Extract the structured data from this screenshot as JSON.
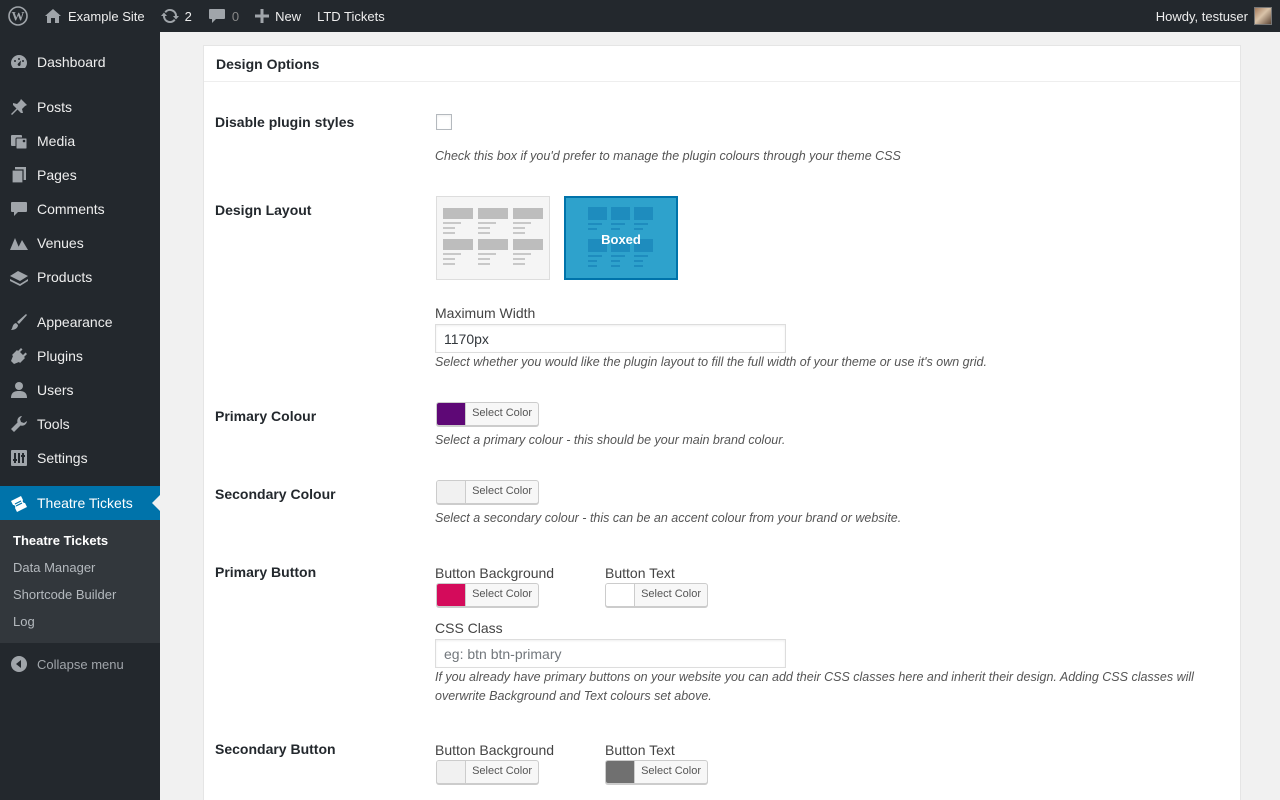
{
  "adminbar": {
    "site_name": "Example Site",
    "updates_count": "2",
    "comments_count": "0",
    "new_label": "New",
    "plugin_link": "LTD Tickets",
    "greeting": "Howdy, testuser"
  },
  "sidebar": {
    "items": [
      {
        "label": "Dashboard",
        "icon": "dashboard-icon"
      },
      {
        "label": "Posts",
        "icon": "pushpin-icon"
      },
      {
        "label": "Media",
        "icon": "media-icon"
      },
      {
        "label": "Pages",
        "icon": "pages-icon"
      },
      {
        "label": "Comments",
        "icon": "comment-icon"
      },
      {
        "label": "Venues",
        "icon": "venues-icon"
      },
      {
        "label": "Products",
        "icon": "products-icon"
      },
      {
        "label": "Appearance",
        "icon": "paintbrush-icon"
      },
      {
        "label": "Plugins",
        "icon": "plugin-icon"
      },
      {
        "label": "Users",
        "icon": "user-icon"
      },
      {
        "label": "Tools",
        "icon": "wrench-icon"
      },
      {
        "label": "Settings",
        "icon": "settings-icon"
      },
      {
        "label": "Theatre Tickets",
        "icon": "tickets-icon"
      }
    ],
    "submenu": [
      "Theatre Tickets",
      "Data Manager",
      "Shortcode Builder",
      "Log"
    ],
    "collapse_label": "Collapse menu"
  },
  "panel": {
    "title": "Design Options",
    "disable_styles": {
      "label": "Disable plugin styles",
      "checked": false,
      "desc": "Check this box if you'd prefer to manage the plugin colours through your theme CSS"
    },
    "design_layout": {
      "label": "Design Layout",
      "selected": "Boxed",
      "boxed_label": "Boxed",
      "max_width_label": "Maximum Width",
      "max_width_value": "1170px",
      "desc": "Select whether you would like the plugin layout to fill the full width of your theme or use it's own grid."
    },
    "primary_colour": {
      "label": "Primary Colour",
      "button": "Select Color",
      "color": "#5e0876",
      "desc": "Select a primary colour - this should be your main brand colour."
    },
    "secondary_colour": {
      "label": "Secondary Colour",
      "button": "Select Color",
      "color": "#f1f1f1",
      "desc": "Select a secondary colour - this can be an accent colour from your brand or website."
    },
    "primary_button": {
      "label": "Primary Button",
      "bg_label": "Button Background",
      "bg_button": "Select Color",
      "bg_color": "#d40b5b",
      "text_label": "Button Text",
      "text_button": "Select Color",
      "text_color": "#ffffff",
      "css_label": "CSS Class",
      "css_placeholder": "eg: btn btn-primary",
      "desc": "If you already have primary buttons on your website you can add their CSS classes here and inherit their design. Adding CSS classes will overwrite Background and Text colours set above."
    },
    "secondary_button": {
      "label": "Secondary Button",
      "bg_label": "Button Background",
      "bg_button": "Select Color",
      "bg_color": "#f1f1f1",
      "text_label": "Button Text",
      "text_button": "Select Color",
      "text_color": "#707070"
    }
  },
  "colors": {
    "admin_bar": "#23282d",
    "menu_highlight": "#0073aa",
    "boxed_layout": "#2ea2cc"
  }
}
